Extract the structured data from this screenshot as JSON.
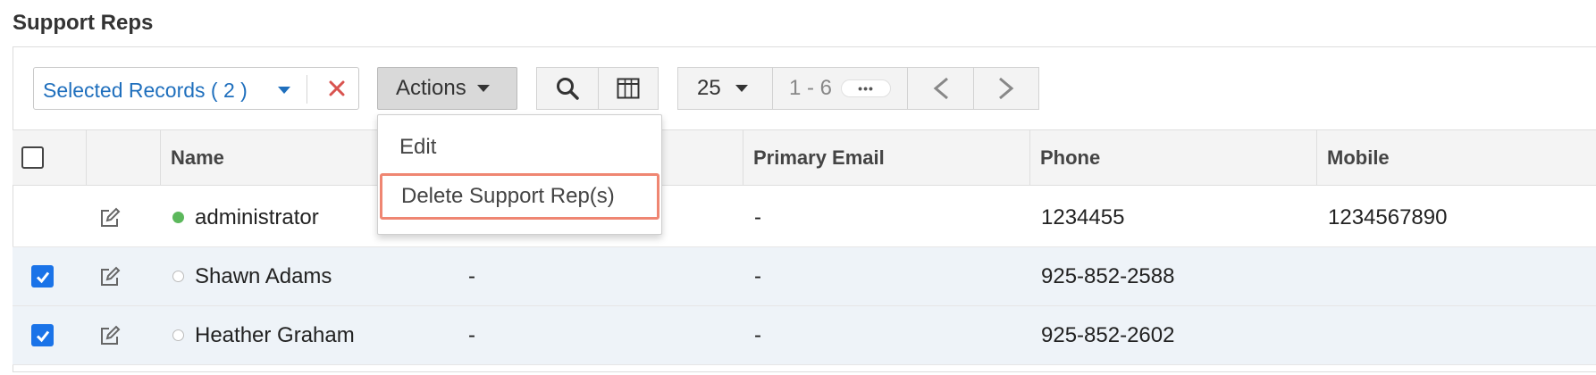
{
  "page": {
    "title": "Support Reps"
  },
  "toolbar": {
    "selected_records_label": "Selected Records ( 2 )",
    "actions_label": "Actions",
    "page_size": "25",
    "page_range": "1 - 6",
    "ellipsis": "•••"
  },
  "actions_menu": {
    "items": [
      {
        "label": "Edit"
      },
      {
        "label": "Delete Support Rep(s)"
      }
    ]
  },
  "table": {
    "columns": [
      "Name",
      "Primary Email",
      "Phone",
      "Mobile"
    ],
    "rows": [
      {
        "checked": false,
        "status": "online",
        "name": "administrator",
        "col2": "",
        "email": "-",
        "phone": "1234455",
        "mobile": "1234567890"
      },
      {
        "checked": true,
        "status": "offline",
        "name": "Shawn Adams",
        "col2": "-",
        "email": "-",
        "phone": "925-852-2588",
        "mobile": ""
      },
      {
        "checked": true,
        "status": "offline",
        "name": "Heather Graham",
        "col2": "-",
        "email": "-",
        "phone": "925-852-2602",
        "mobile": ""
      }
    ]
  },
  "colors": {
    "accent_blue": "#1f6fbd",
    "checkbox_blue": "#1a73e8",
    "clear_red": "#d9534f",
    "online_green": "#5cb85c",
    "highlight_border": "#ef8672",
    "selected_row_bg": "#eef3f8"
  }
}
